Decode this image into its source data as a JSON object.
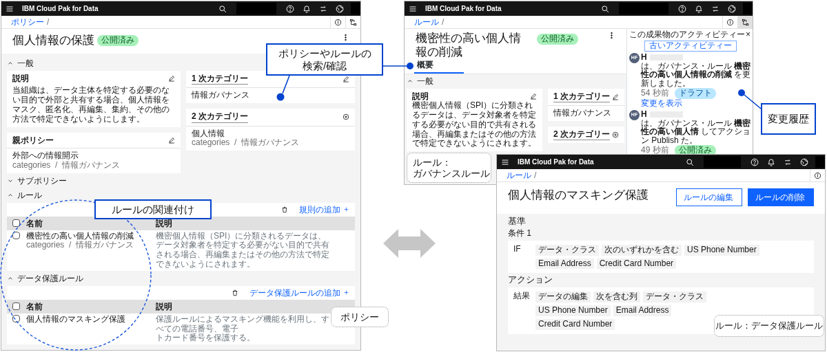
{
  "policy_window": {
    "app_title": "IBM Cloud Pak for Data",
    "breadcrumb": {
      "link": "ポリシー",
      "separator": "/"
    },
    "title": "個人情報の保護",
    "status": {
      "label": "公開済み",
      "kind": "published"
    },
    "general": {
      "heading": "一般",
      "expanded": true,
      "description": {
        "label": "説明",
        "text": "当組織は、データ主体を特定する必要のない目的で外部と共有する場合、個人情報をマスク、匿名化、再編集、集約、その他の方法で特定できないようにします。"
      },
      "parent_policy": {
        "label": "親ポリシー",
        "value": "外部への情報開示",
        "path": "categories  /  情報ガバナンス"
      },
      "primary_category": {
        "label": "1 次カテゴリー",
        "value": "情報ガバナンス"
      },
      "secondary_category": {
        "label": "2 次カテゴリー",
        "value": "個人情報",
        "path": "categories  /  情報ガバナンス"
      }
    },
    "sections": [
      {
        "heading": "サブポリシー",
        "expanded": false
      },
      {
        "heading": "ルール",
        "expanded": true,
        "add_link": "規則の追加",
        "select_all_checked": false,
        "columns": [
          "名前",
          "説明"
        ],
        "rows": [
          {
            "name": "機密性の高い個人情報の削減",
            "path": "categories  /  情報ガバナンス",
            "description_lines": [
              "機密個人情報（SPI）に分類されるデータは、データ対象者を特定する必要がない目的で共有される場合、再編集またはその他の方法で特定できないようにされます。"
            ],
            "checked": false
          }
        ]
      },
      {
        "heading": "データ保護ルール",
        "expanded": true,
        "add_link": "データ保護ルールの追加",
        "select_all_checked": false,
        "columns": [
          "名前",
          "説明"
        ],
        "rows": [
          {
            "name": "個人情報のマスキング保護",
            "description_lines": [
              "保護ルールによるマスキング機能を利用し、すべての電話番号、電子",
              "トカード番号を保護する。"
            ],
            "checked": false
          }
        ]
      }
    ]
  },
  "governance_rule_window": {
    "app_title": "IBM Cloud Pak for Data",
    "breadcrumb": {
      "link": "ルール",
      "separator": "/"
    },
    "title": "機密性の高い個人情報の削減",
    "status": {
      "label": "公開済み",
      "kind": "published"
    },
    "tabs": [
      {
        "label": "概要",
        "selected": true
      }
    ],
    "general": {
      "heading": "一般",
      "expanded": true,
      "description": {
        "label": "説明",
        "text": "機密個人情報（SPI）に分類されるデータは、データ対象者を特定する必要がない目的で共有される場合、再編集またはその他の方法で特定できないようにされます。"
      },
      "primary_category": {
        "label": "1 次カテゴリー",
        "value": "情報ガバナンス"
      },
      "secondary_category": {
        "label": "2 次カテゴリー"
      }
    },
    "activity": {
      "title": "この成果物のアクティビティー",
      "close": "×",
      "older_button": "古いアクティビティー",
      "entries": [
        {
          "avatar": "HF",
          "user": "H",
          "text": "は、ガバナンス・ルール **機密性の高い個人情報の削減** を更新しました。",
          "time": "54 秒前",
          "status": {
            "label": "ドラフト",
            "kind": "draft"
          },
          "link": "変更を表示"
        },
        {
          "avatar": "HF",
          "user": "H",
          "text": "は、ガバナンス・ルール **機密性の高い個人情** してアクション Publish た。",
          "time": "49 秒前",
          "status": {
            "label": "公開済み",
            "kind": "published"
          }
        }
      ]
    }
  },
  "protection_rule_window": {
    "app_title": "IBM Cloud Pak for Data",
    "breadcrumb": {
      "link": "ルール",
      "separator": "/"
    },
    "title": "個人情報のマスキング保護",
    "buttons": [
      {
        "label": "ルールの編集",
        "kind": "secondary"
      },
      {
        "label": "ルールの削除",
        "kind": "primary"
      }
    ],
    "criteria": {
      "heading": "基準",
      "condition_label": "条件 1",
      "keyword": "IF",
      "tags": [
        "データ・クラス",
        "次のいずれかを含む",
        "US Phone Number",
        "Email Address",
        "Credit Card Number"
      ]
    },
    "action": {
      "heading": "アクション",
      "keyword": "結果",
      "tags": [
        "データの編集",
        "次を含む列",
        "データ・クラス",
        "US Phone Number",
        "Email Address",
        "Credit Card Number"
      ]
    }
  },
  "callouts": [
    {
      "kind": "box",
      "lines": [
        "ポリシーやルールの",
        "検索/確認"
      ]
    },
    {
      "kind": "box",
      "lines": [
        "ルールの関連付け"
      ]
    },
    {
      "kind": "box",
      "lines": [
        "変更履歴"
      ]
    },
    {
      "kind": "note",
      "lines": [
        "ポリシー"
      ]
    },
    {
      "kind": "note",
      "lines": [
        "ルール：",
        "ガバナンスルール"
      ]
    },
    {
      "kind": "note",
      "lines": [
        "ルール：データ保護ルール"
      ]
    }
  ]
}
